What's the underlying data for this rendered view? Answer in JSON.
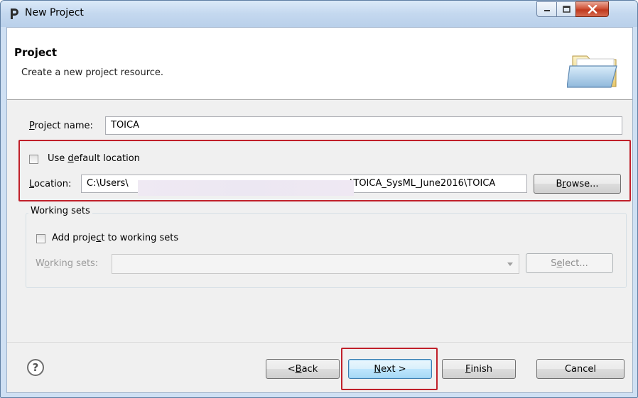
{
  "window": {
    "title": "New Project",
    "icon": "eclipse-p-icon"
  },
  "banner": {
    "title": "Project",
    "subtitle": "Create a new project resource.",
    "icon": "folder-open-icon"
  },
  "project_name": {
    "label_pre": "",
    "label_ul": "P",
    "label_post": "roject name:",
    "value": "TOICA"
  },
  "default_location": {
    "label_pre": "Use ",
    "label_ul": "d",
    "label_post": "efault location",
    "checked": false
  },
  "location": {
    "label_pre": "",
    "label_ul": "L",
    "label_post": "ocation:",
    "value_start": "C:\\Users\\",
    "value_end": "\\TOICA_SysML_June2016\\TOICA",
    "browse_pre": "B",
    "browse_ul": "r",
    "browse_post": "owse..."
  },
  "working_sets_group": {
    "title": "Working sets",
    "add_pre": "Add proje",
    "add_ul": "c",
    "add_post": "t to working sets",
    "add_checked": false,
    "combo_label_pre": "W",
    "combo_label_ul": "o",
    "combo_label_post": "rking sets:",
    "select_pre": "S",
    "select_ul": "e",
    "select_post": "lect..."
  },
  "buttons": {
    "back_pre": "< ",
    "back_ul": "B",
    "back_post": "ack",
    "next_ul": "N",
    "next_post": "ext >",
    "finish_ul": "F",
    "finish_post": "inish",
    "cancel": "Cancel"
  },
  "help": "?",
  "colors": {
    "highlight": "#c0202a",
    "title_bar": "#c4d8ef",
    "dialog_bg": "#f0f0f0"
  }
}
